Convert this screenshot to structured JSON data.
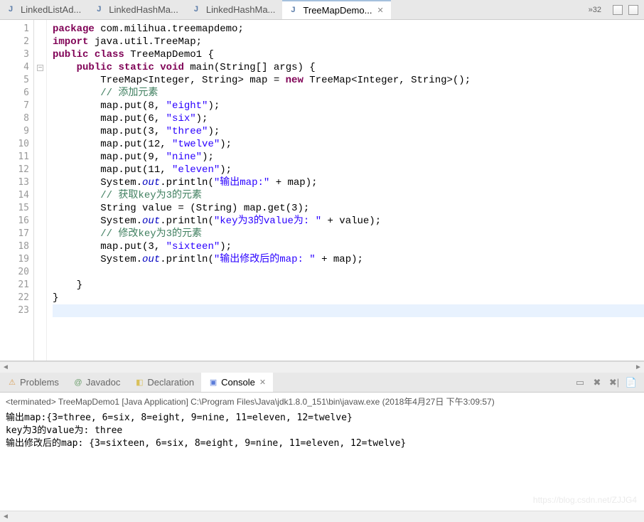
{
  "tabs": [
    {
      "label": "LinkedListAd...",
      "active": false
    },
    {
      "label": "LinkedHashMa...",
      "active": false
    },
    {
      "label": "LinkedHashMa...",
      "active": false
    },
    {
      "label": "TreeMapDemo...",
      "active": true
    }
  ],
  "overflow": "»32",
  "code": {
    "lines": [
      {
        "n": "1",
        "html": "<span class='kw'>package</span> com.milihua.treemapdemo;"
      },
      {
        "n": "2",
        "html": "<span class='kw'>import</span> java.util.TreeMap;"
      },
      {
        "n": "3",
        "html": "<span class='kw'>public</span> <span class='kw'>class</span> TreeMapDemo1 {"
      },
      {
        "n": "4",
        "html": "    <span class='kw'>public</span> <span class='kw'>static</span> <span class='kw'>void</span> main(String[] args) {",
        "fold": true
      },
      {
        "n": "5",
        "html": "        TreeMap&lt;Integer, String&gt; map = <span class='kw'>new</span> TreeMap&lt;Integer, String&gt;();"
      },
      {
        "n": "6",
        "html": "        <span class='com'>// 添加元素</span>"
      },
      {
        "n": "7",
        "html": "        map.put(8, <span class='str'>\"eight\"</span>);"
      },
      {
        "n": "8",
        "html": "        map.put(6, <span class='str'>\"six\"</span>);"
      },
      {
        "n": "9",
        "html": "        map.put(3, <span class='str'>\"three\"</span>);"
      },
      {
        "n": "10",
        "html": "        map.put(12, <span class='str'>\"twelve\"</span>);"
      },
      {
        "n": "11",
        "html": "        map.put(9, <span class='str'>\"nine\"</span>);"
      },
      {
        "n": "12",
        "html": "        map.put(11, <span class='str'>\"eleven\"</span>);"
      },
      {
        "n": "13",
        "html": "        System.<span class='field'>out</span>.println(<span class='str'>\"输出map:\"</span> + map);"
      },
      {
        "n": "14",
        "html": "        <span class='com'>// 获取key为3的元素</span>"
      },
      {
        "n": "15",
        "html": "        String value = (String) map.get(3);"
      },
      {
        "n": "16",
        "html": "        System.<span class='field'>out</span>.println(<span class='str'>\"key为3的value为: \"</span> + value);"
      },
      {
        "n": "17",
        "html": "        <span class='com'>// 修改key为3的元素</span>"
      },
      {
        "n": "18",
        "html": "        map.put(3, <span class='str'>\"sixteen\"</span>);"
      },
      {
        "n": "19",
        "html": "        System.<span class='field'>out</span>.println(<span class='str'>\"输出修改后的map: \"</span> + map);"
      },
      {
        "n": "20",
        "html": ""
      },
      {
        "n": "21",
        "html": "    }"
      },
      {
        "n": "22",
        "html": "}"
      },
      {
        "n": "23",
        "html": "",
        "current": true
      }
    ]
  },
  "bottom_tabs": [
    {
      "label": "Problems",
      "icon": "⚠",
      "color": "#d9a05a"
    },
    {
      "label": "Javadoc",
      "icon": "@",
      "color": "#6b9e6b"
    },
    {
      "label": "Declaration",
      "icon": "◧",
      "color": "#d9c05a"
    },
    {
      "label": "Console",
      "icon": "▣",
      "color": "#5a7bd9",
      "active": true
    }
  ],
  "console": {
    "header": "<terminated> TreeMapDemo1 [Java Application] C:\\Program Files\\Java\\jdk1.8.0_151\\bin\\javaw.exe (2018年4月27日 下午3:09:57)",
    "lines": [
      "输出map:{3=three, 6=six, 8=eight, 9=nine, 11=eleven, 12=twelve}",
      "key为3的value为: three",
      "输出修改后的map: {3=sixteen, 6=six, 8=eight, 9=nine, 11=eleven, 12=twelve}"
    ]
  },
  "watermark": "https://blog.csdn.net/ZJJG4"
}
